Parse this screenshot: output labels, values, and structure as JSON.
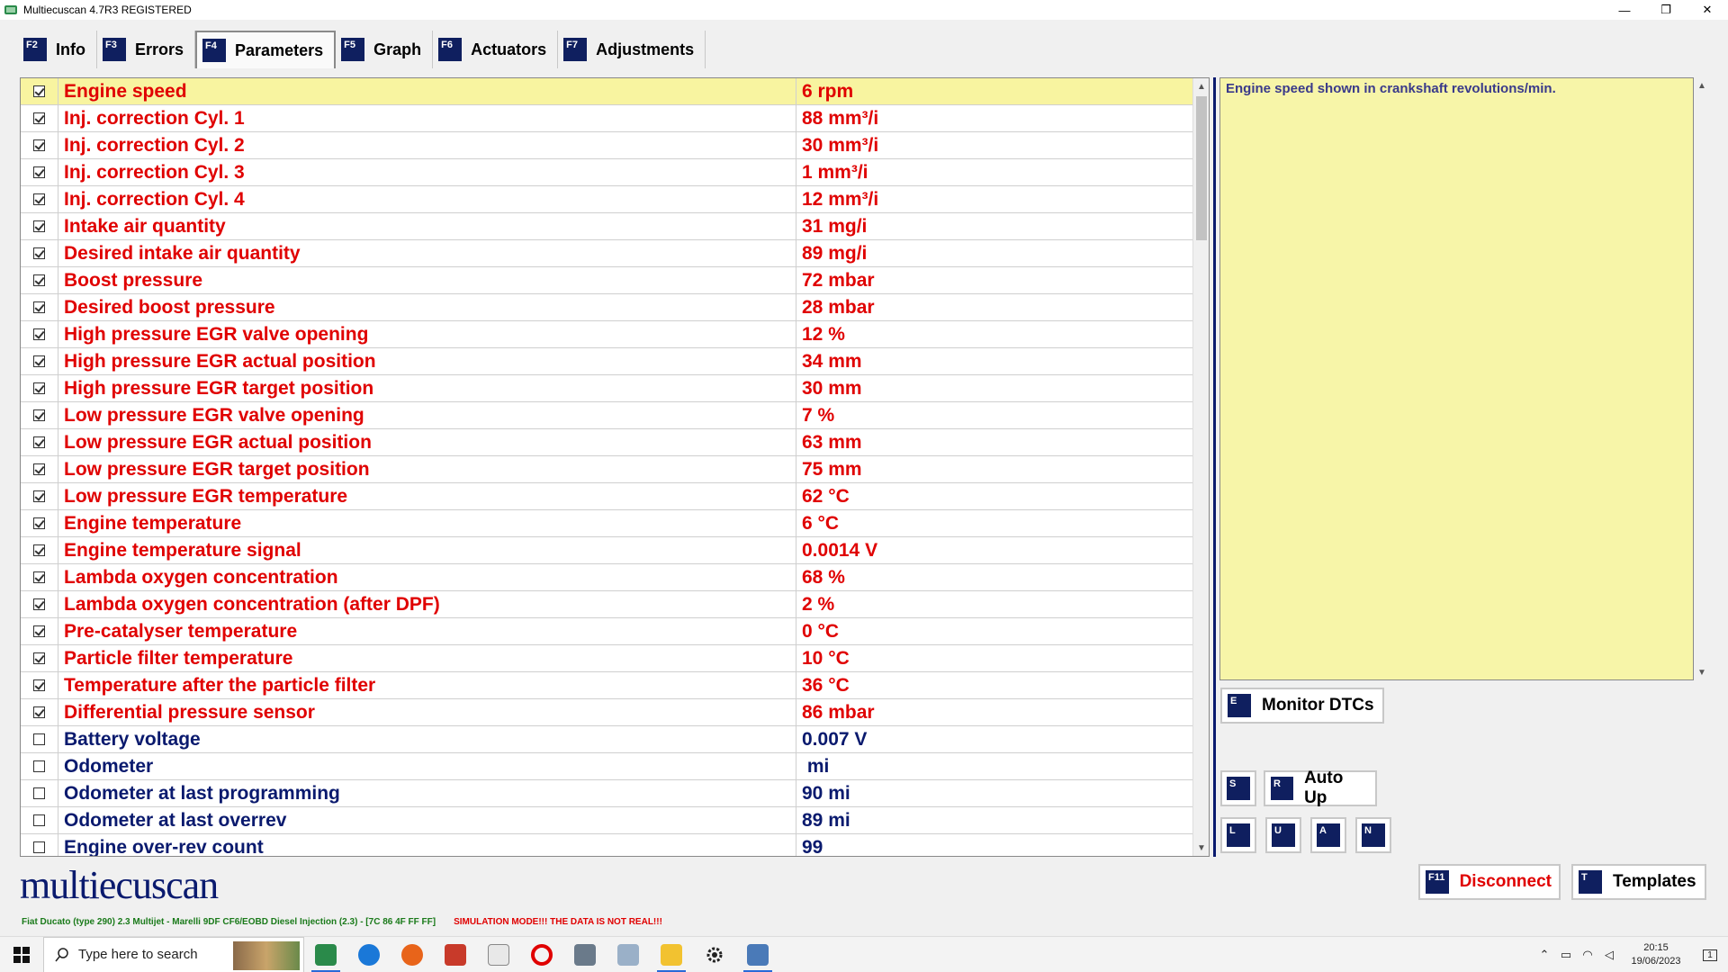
{
  "window": {
    "title": "Multiecuscan 4.7R3 REGISTERED",
    "controls": {
      "minimize": "—",
      "restore": "❐",
      "close": "✕"
    }
  },
  "tabs": [
    {
      "key": "F2",
      "label": "Info"
    },
    {
      "key": "F3",
      "label": "Errors"
    },
    {
      "key": "F4",
      "label": "Parameters"
    },
    {
      "key": "F5",
      "label": "Graph"
    },
    {
      "key": "F6",
      "label": "Actuators"
    },
    {
      "key": "F7",
      "label": "Adjustments"
    }
  ],
  "active_tab": "Parameters",
  "parameters": [
    {
      "checked": true,
      "name": "Engine speed",
      "value": "6 rpm"
    },
    {
      "checked": true,
      "name": "Inj. correction Cyl. 1",
      "value": "88 mm³/i"
    },
    {
      "checked": true,
      "name": "Inj. correction Cyl. 2",
      "value": "30 mm³/i"
    },
    {
      "checked": true,
      "name": "Inj. correction Cyl. 3",
      "value": "1 mm³/i"
    },
    {
      "checked": true,
      "name": "Inj. correction Cyl. 4",
      "value": "12 mm³/i"
    },
    {
      "checked": true,
      "name": "Intake air quantity",
      "value": "31 mg/i"
    },
    {
      "checked": true,
      "name": "Desired intake air quantity",
      "value": "89 mg/i"
    },
    {
      "checked": true,
      "name": "Boost pressure",
      "value": "72 mbar"
    },
    {
      "checked": true,
      "name": "Desired boost pressure",
      "value": "28 mbar"
    },
    {
      "checked": true,
      "name": "High pressure EGR valve opening",
      "value": "12 %"
    },
    {
      "checked": true,
      "name": "High pressure EGR actual position",
      "value": "34 mm"
    },
    {
      "checked": true,
      "name": "High pressure EGR target position",
      "value": "30 mm"
    },
    {
      "checked": true,
      "name": "Low pressure EGR valve opening",
      "value": "7 %"
    },
    {
      "checked": true,
      "name": "Low pressure EGR actual position",
      "value": "63 mm"
    },
    {
      "checked": true,
      "name": "Low pressure EGR target position",
      "value": "75 mm"
    },
    {
      "checked": true,
      "name": "Low pressure EGR temperature",
      "value": "62 °C"
    },
    {
      "checked": true,
      "name": "Engine temperature",
      "value": "6 °C"
    },
    {
      "checked": true,
      "name": "Engine temperature signal",
      "value": "0.0014 V"
    },
    {
      "checked": true,
      "name": "Lambda oxygen concentration",
      "value": "68 %"
    },
    {
      "checked": true,
      "name": "Lambda oxygen concentration (after DPF)",
      "value": "2 %"
    },
    {
      "checked": true,
      "name": "Pre-catalyser temperature",
      "value": "0 °C"
    },
    {
      "checked": true,
      "name": "Particle filter temperature",
      "value": "10 °C"
    },
    {
      "checked": true,
      "name": "Temperature after the particle filter",
      "value": "36 °C"
    },
    {
      "checked": true,
      "name": "Differential pressure sensor",
      "value": "86 mbar"
    },
    {
      "checked": false,
      "name": "Battery voltage",
      "value": "0.007 V"
    },
    {
      "checked": false,
      "name": "Odometer",
      "value": " mi"
    },
    {
      "checked": false,
      "name": "Odometer at last programming",
      "value": "90 mi"
    },
    {
      "checked": false,
      "name": "Odometer at last overrev",
      "value": "89 mi"
    },
    {
      "checked": false,
      "name": "Engine over-rev count",
      "value": "99"
    }
  ],
  "selected_row": 0,
  "colors": {
    "checked_text": "#e00000",
    "unchecked_text": "#0a1a6e",
    "selected_bg": "#f8f4a0",
    "key_badge": "#0f1f5f"
  },
  "description": "Engine speed shown in crankshaft revolutions/min.",
  "buttons": {
    "monitor_dtcs": {
      "key": "E",
      "label": "Monitor DTCs"
    },
    "s": {
      "key": "S"
    },
    "auto_up": {
      "key": "R",
      "label": "Auto Up"
    },
    "l": {
      "key": "L"
    },
    "u": {
      "key": "U"
    },
    "a": {
      "key": "A"
    },
    "n": {
      "key": "N"
    },
    "disconnect": {
      "key": "F11",
      "label": "Disconnect"
    },
    "templates": {
      "key": "T",
      "label": "Templates"
    }
  },
  "logo": "multiecuscan",
  "status": {
    "vehicle": "Fiat Ducato (type 290) 2.3 Multijet - Marelli 9DF CF6/EOBD Diesel Injection (2.3) - [7C 86 4F FF FF]",
    "simulation": "SIMULATION MODE!!! THE DATA IS NOT REAL!!!"
  },
  "taskbar": {
    "search_placeholder": "Type here to search",
    "clock_time": "20:15",
    "clock_date": "19/06/2023",
    "notification_count": "1"
  }
}
